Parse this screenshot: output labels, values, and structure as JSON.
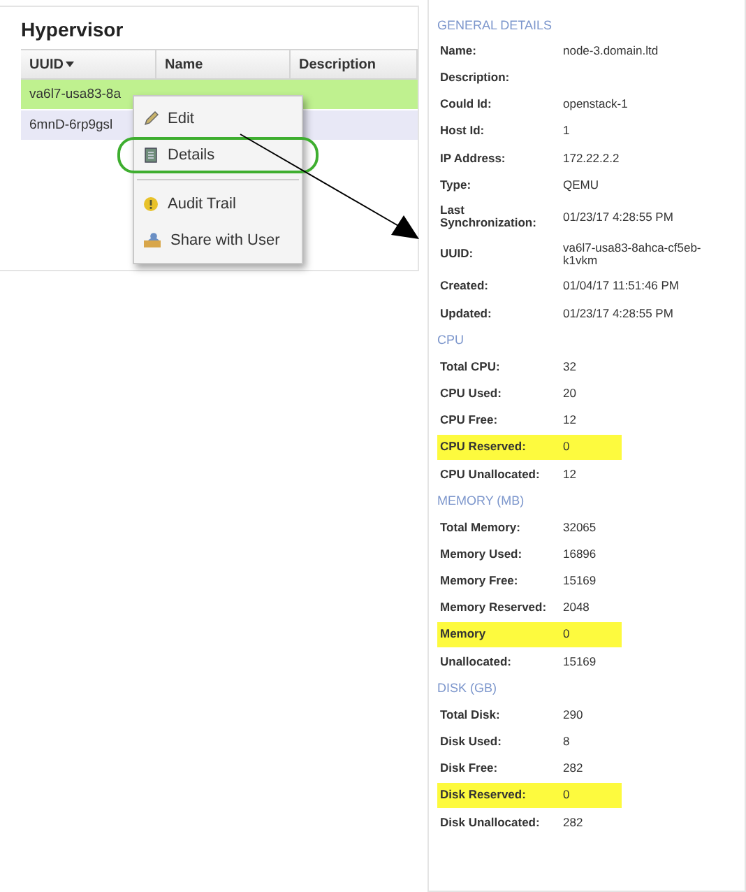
{
  "hypervisor": {
    "title": "Hypervisor",
    "columns": [
      {
        "label": "UUID",
        "sorted": true
      },
      {
        "label": "Name",
        "sorted": false
      },
      {
        "label": "Description",
        "sorted": false
      }
    ],
    "rows": [
      {
        "uuid": "va6l7-usa83-8a",
        "selected": true
      },
      {
        "uuid": "6mnD-6rp9gsl",
        "selected": false
      }
    ]
  },
  "context_menu": {
    "items": [
      {
        "label": "Edit",
        "kind": "edit",
        "highlighted": false,
        "separator_before": false
      },
      {
        "label": "Details",
        "kind": "details",
        "highlighted": true,
        "separator_before": false
      },
      {
        "label": "Audit Trail",
        "kind": "audit",
        "highlighted": false,
        "separator_before": true
      },
      {
        "label": "Share with User",
        "kind": "share",
        "highlighted": false,
        "separator_before": false
      }
    ]
  },
  "details": {
    "sections": [
      {
        "title": "GENERAL DETAILS",
        "rows": [
          {
            "label": "Name:",
            "value": "node-3.domain.ltd",
            "highlighted": false
          },
          {
            "label": "Description:",
            "value": "",
            "highlighted": false
          },
          {
            "label": "Could Id:",
            "value": "openstack-1",
            "highlighted": false
          },
          {
            "label": "Host Id:",
            "value": "1",
            "highlighted": false
          },
          {
            "label": "IP Address:",
            "value": "172.22.2.2",
            "highlighted": false
          },
          {
            "label": "Type:",
            "value": "QEMU",
            "highlighted": false
          },
          {
            "label": "Last Synchronization:",
            "value": "01/23/17 4:28:55 PM",
            "highlighted": false
          },
          {
            "label": "UUID:",
            "value": "va6l7-usa83-8ahca-cf5eb-k1vkm",
            "highlighted": false
          },
          {
            "label": "Created:",
            "value": "01/04/17 11:51:46 PM",
            "highlighted": false
          },
          {
            "label": "Updated:",
            "value": "01/23/17 4:28:55 PM",
            "highlighted": false
          }
        ]
      },
      {
        "title": "CPU",
        "rows": [
          {
            "label": "Total CPU:",
            "value": "32",
            "highlighted": false
          },
          {
            "label": "CPU Used:",
            "value": "20",
            "highlighted": false
          },
          {
            "label": "CPU Free:",
            "value": "12",
            "highlighted": false
          },
          {
            "label": "CPU Reserved:",
            "value": "0",
            "highlighted": true
          },
          {
            "label": "CPU Unallocated:",
            "value": "12",
            "highlighted": false
          }
        ]
      },
      {
        "title": "MEMORY (MB)",
        "rows": [
          {
            "label": "Total Memory:",
            "value": "32065",
            "highlighted": false
          },
          {
            "label": "Memory Used:",
            "value": "16896",
            "highlighted": false
          },
          {
            "label": "Memory Free:",
            "value": "15169",
            "highlighted": false
          },
          {
            "label": "Memory Reserved:",
            "value": "2048",
            "highlighted": false
          },
          {
            "label": "Memory",
            "value": "0",
            "highlighted": true
          },
          {
            "label": "Unallocated:",
            "value": "15169",
            "highlighted": false
          }
        ]
      },
      {
        "title": "DISK (GB)",
        "rows": [
          {
            "label": "Total Disk:",
            "value": "290",
            "highlighted": false
          },
          {
            "label": "Disk Used:",
            "value": "8",
            "highlighted": false
          },
          {
            "label": "Disk Free:",
            "value": "282",
            "highlighted": false
          },
          {
            "label": "Disk Reserved:",
            "value": "0",
            "highlighted": true
          },
          {
            "label": "Disk Unallocated:",
            "value": "282",
            "highlighted": false
          }
        ]
      }
    ]
  }
}
